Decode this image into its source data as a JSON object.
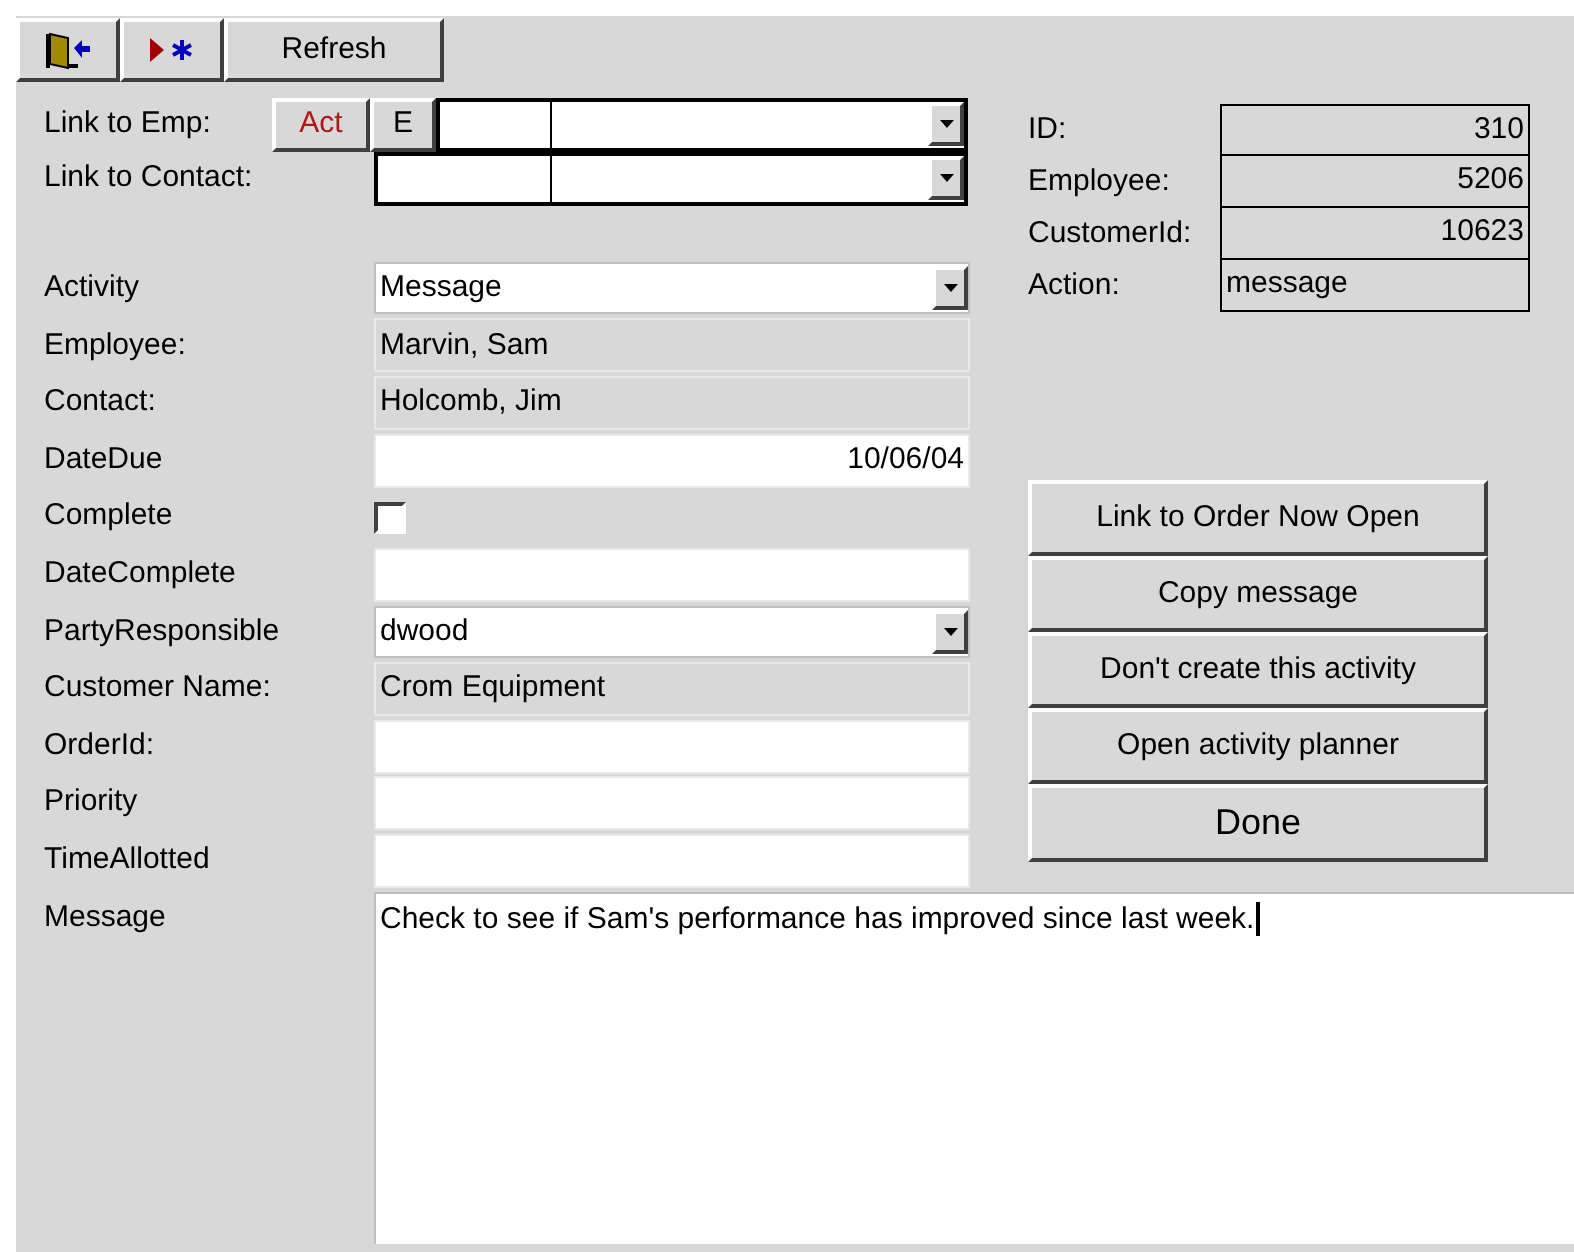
{
  "toolbar": [
    {
      "kind": "exit"
    },
    {
      "kind": "new"
    },
    {
      "kind": "text",
      "label": "Refresh"
    }
  ],
  "links": [
    {
      "label": "Link to Emp:",
      "buttons": [
        {
          "label": "Act",
          "kind": "red"
        },
        {
          "label": "E",
          "kind": "plain"
        }
      ]
    },
    {
      "label": "Link to Contact:"
    }
  ],
  "fields": [
    {
      "label": "Activity",
      "kind": "combo",
      "value": "Message"
    },
    {
      "label": "Employee:",
      "kind": "readonly",
      "value": "Marvin, Sam"
    },
    {
      "label": "Contact:",
      "kind": "readonly",
      "value": "Holcomb, Jim"
    },
    {
      "label": "DateDue",
      "kind": "date",
      "value": "10/06/04"
    },
    {
      "label": "Complete",
      "kind": "checkbox",
      "checked": false
    },
    {
      "label": "DateComplete",
      "kind": "text"
    },
    {
      "label": "PartyResponsible",
      "kind": "combo",
      "value": "dwood"
    },
    {
      "label": "Customer Name:",
      "kind": "readonly",
      "value": "Crom Equipment"
    },
    {
      "label": "OrderId:",
      "kind": "text"
    },
    {
      "label": "Priority",
      "kind": "text"
    },
    {
      "label": "TimeAllotted",
      "kind": "text"
    }
  ],
  "info": [
    {
      "label": "ID:",
      "value": "310",
      "kind": "number"
    },
    {
      "label": "Employee:",
      "value": "5206",
      "kind": "number"
    },
    {
      "label": "CustomerId:",
      "value": "10623",
      "kind": "number"
    },
    {
      "label": "Action:",
      "value": "message",
      "kind": "text"
    }
  ],
  "actions": [
    {
      "label": "Link to Order Now Open",
      "kind": "normal"
    },
    {
      "label": "Copy message",
      "kind": "normal"
    },
    {
      "label": "Don't create this activity",
      "kind": "normal"
    },
    {
      "label": "Open activity planner",
      "kind": "normal"
    },
    {
      "label": "Done",
      "kind": "large"
    }
  ],
  "message": {
    "label": "Message",
    "value": "Check to see if Sam's performance has improved since last week."
  }
}
